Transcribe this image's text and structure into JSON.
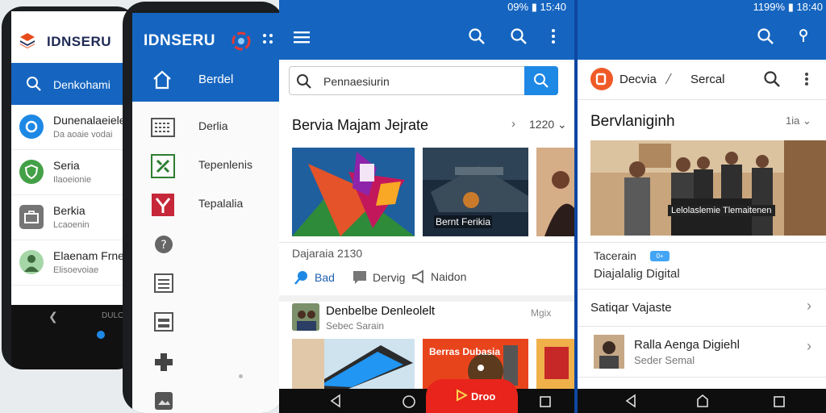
{
  "colors": {
    "primary": "#1565c0",
    "accent": "#1e88e5",
    "fab": "#e8241c",
    "brand_logo": "#f05a28",
    "badge": "#42a5f5"
  },
  "phone1": {
    "brand": "IDNSERU",
    "search_text": "Denkohami",
    "items": [
      {
        "title": "Dunenalaeieleer",
        "subtitle": "Da aoaie vodai",
        "icon": "circle-icon",
        "color": "#1e88e5"
      },
      {
        "title": "Seria",
        "subtitle": "Ilaoeionie",
        "icon": "shield-icon",
        "color": "#43a047"
      },
      {
        "title": "Berkia",
        "subtitle": "Lcaoenin",
        "icon": "briefcase-icon",
        "color": "#757575"
      },
      {
        "title": "Elaenam Frner",
        "subtitle": "Elisoevoiae",
        "icon": "person-icon",
        "color": "#66bb6a"
      }
    ],
    "nav_label": "DULO"
  },
  "phone2": {
    "brand": "IDNSERU",
    "beranda": "Berdel",
    "menu": [
      {
        "label": "Derlia",
        "icon": "keyboard-icon"
      },
      {
        "label": "Tepenlenis",
        "icon": "tools-icon"
      },
      {
        "label": "Tepalalia",
        "icon": "bookmark-icon"
      }
    ]
  },
  "screen3": {
    "status_text": "09% ▮ 15:40",
    "search_placeholder": "Pennaesiurin",
    "section1_title": "Bervia Majam Jejrate",
    "section1_count": "1220",
    "thumb2_label": "Bernt Ferikia",
    "section2_title": "Dajaraia 2130",
    "chips": [
      {
        "label": "Bad",
        "icon": "pin-icon"
      },
      {
        "label": "Dervig",
        "icon": "tag-icon"
      },
      {
        "label": "Naidon",
        "icon": "megaphone-icon"
      }
    ],
    "news": {
      "title": "Denbelbe Denleolelt",
      "subtitle": "Sebec Sarain",
      "meta": "Mgix"
    },
    "bottom2_label": "Berras Dubasia",
    "fab_label": "Droo"
  },
  "screen4": {
    "status_text": "1199% ▮ 18:40",
    "brand": "Decvia",
    "tab": "Sercal",
    "title": "Bervlaniginh",
    "title_meta": "1ia",
    "hero_caption": "Lelolaslemie Tlemaitenen",
    "tag": "Tacerain",
    "badge": "0+",
    "description": "Diajalalig Digital",
    "row1": "Satiqar Vajaste",
    "row2_title": "Ralla Aenga Digiehl",
    "row2_subtitle": "Seder Semal"
  }
}
